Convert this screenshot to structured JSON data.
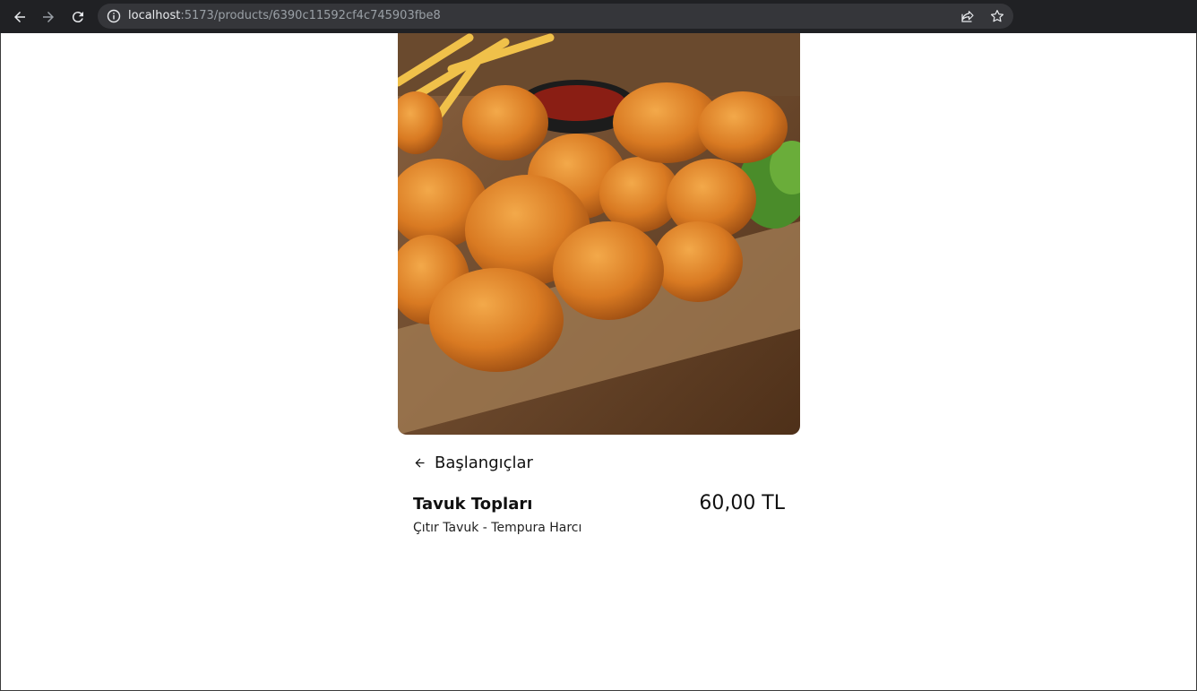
{
  "browser": {
    "url_host": "localhost",
    "url_path": ":5173/products/6390c11592cf4c745903fbe8",
    "icons": [
      "back-arrow-icon",
      "forward-arrow-icon",
      "reload-icon",
      "info-icon",
      "share-icon",
      "star-icon"
    ]
  },
  "product": {
    "category_back_label": "Başlangıçlar",
    "name": "Tavuk Topları",
    "description": "Çıtır Tavuk - Tempura Harcı",
    "price": "60,00 TL"
  },
  "colors": {
    "toolbar": "#202124",
    "omnibox": "#35363a",
    "text": "#111111"
  }
}
